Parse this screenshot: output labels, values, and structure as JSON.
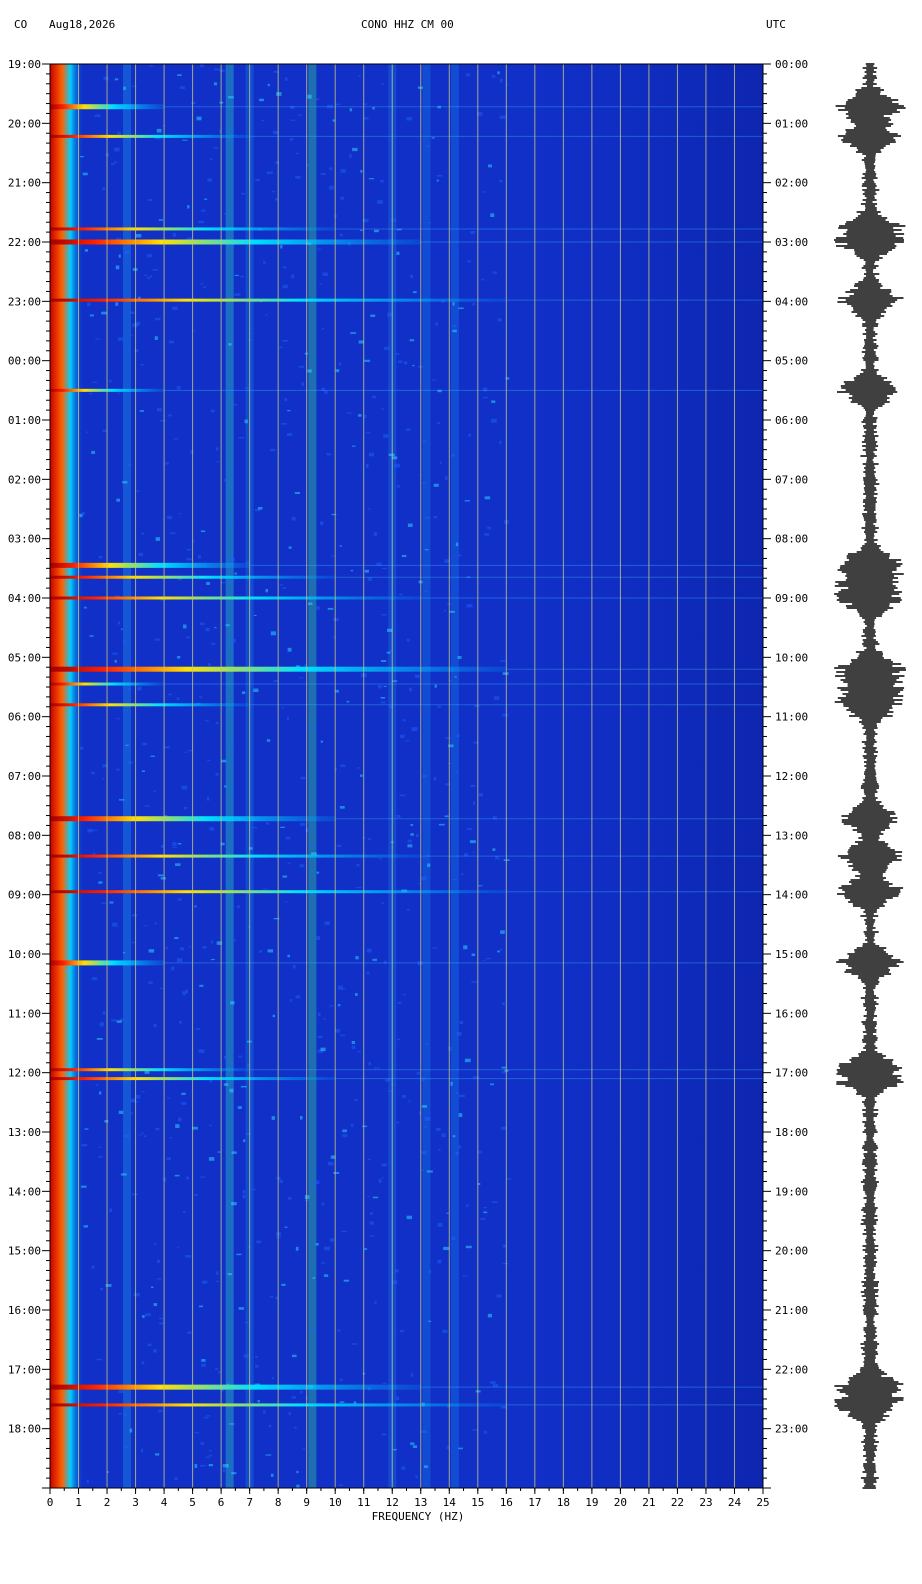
{
  "header": {
    "network": "CO",
    "date": "Aug18,2026",
    "station": "CONO HHZ CM 00",
    "timezone": "UTC"
  },
  "chart_data": {
    "type": "heatmap",
    "xlabel": "FREQUENCY (HZ)",
    "xlim": [
      0,
      25
    ],
    "x_ticks": [
      "0",
      "1",
      "2",
      "3",
      "4",
      "5",
      "6",
      "7",
      "8",
      "9",
      "10",
      "11",
      "12",
      "13",
      "14",
      "15",
      "16",
      "17",
      "18",
      "19",
      "20",
      "21",
      "22",
      "23",
      "24",
      "25"
    ],
    "left_time_labels": [
      "19:00",
      "20:00",
      "21:00",
      "22:00",
      "23:00",
      "00:00",
      "01:00",
      "02:00",
      "03:00",
      "04:00",
      "05:00",
      "06:00",
      "07:00",
      "08:00",
      "09:00",
      "10:00",
      "11:00",
      "12:00",
      "13:00",
      "14:00",
      "15:00",
      "16:00",
      "17:00",
      "18:00"
    ],
    "right_time_labels": [
      "00:00",
      "01:00",
      "02:00",
      "03:00",
      "04:00",
      "05:00",
      "06:00",
      "07:00",
      "08:00",
      "09:00",
      "10:00",
      "11:00",
      "12:00",
      "13:00",
      "14:00",
      "15:00",
      "16:00",
      "17:00",
      "18:00",
      "19:00",
      "20:00",
      "21:00",
      "22:00",
      "23:00"
    ],
    "hours_span": 24,
    "colormap": [
      "#00008b",
      "#0000ff",
      "#00c8ff",
      "#00ff80",
      "#ffff00",
      "#ff0000",
      "#8b0000"
    ],
    "background_color": "#1030c8",
    "gridline_color": "#c8c878",
    "event_hours": [
      0.72,
      1.22,
      2.78,
      3.0,
      3.98,
      5.5,
      8.45,
      8.65,
      9.0,
      10.2,
      10.45,
      10.8,
      12.72,
      13.35,
      13.95,
      15.15,
      16.95,
      17.1,
      22.3,
      22.6
    ]
  }
}
